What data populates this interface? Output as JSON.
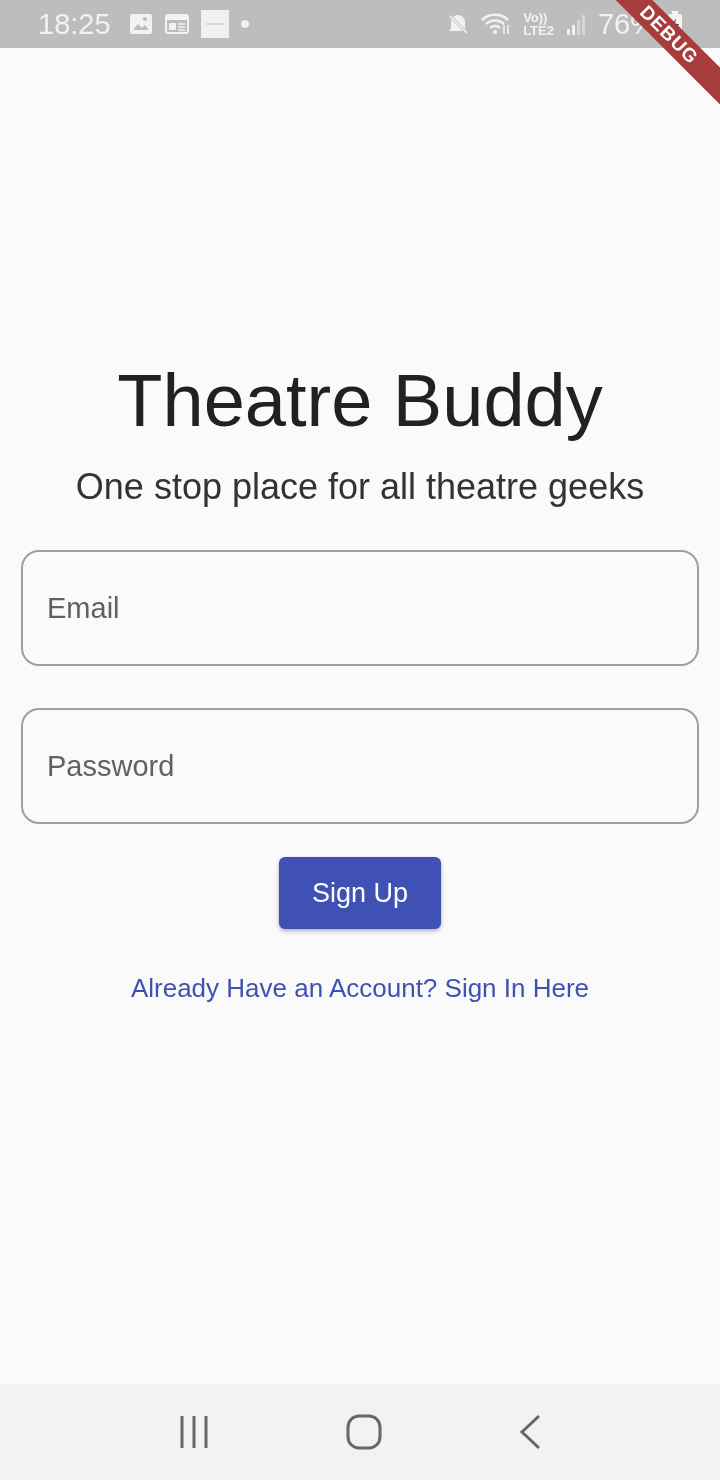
{
  "status_bar": {
    "time": "18:25",
    "volte": "Vo))",
    "network": "LTE2",
    "battery": "76%"
  },
  "debug_banner": "DEBUG",
  "title": "Theatre Buddy",
  "subtitle": "One stop place for all theatre geeks",
  "fields": [
    {
      "placeholder": "Email"
    },
    {
      "placeholder": "Password"
    }
  ],
  "button": "Sign Up",
  "link": "Already Have an Account? Sign In Here"
}
